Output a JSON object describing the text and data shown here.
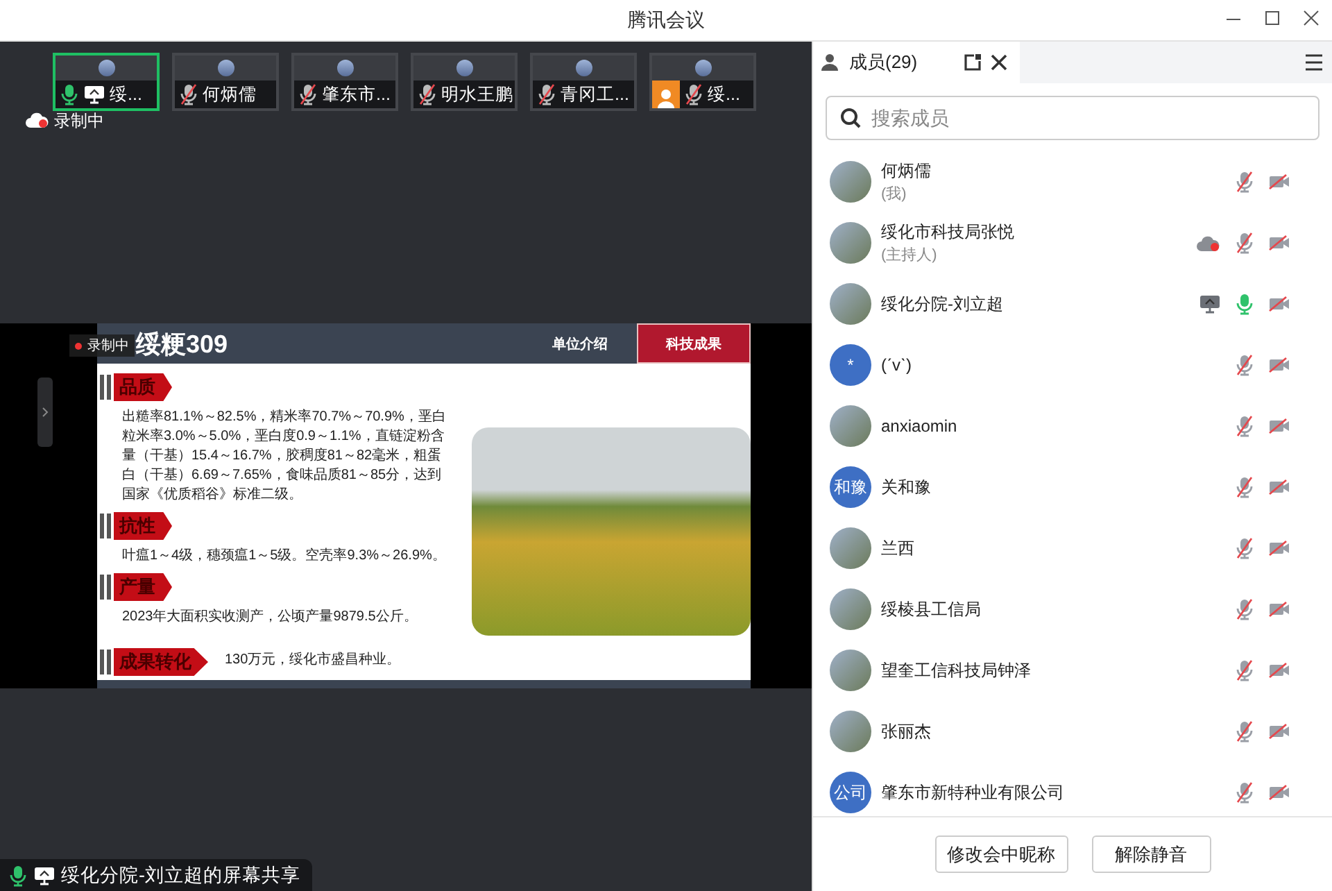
{
  "window": {
    "title": "腾讯会议"
  },
  "thumbnails": [
    {
      "name": "绥...",
      "mic_on": true,
      "sharing": true,
      "selected": true,
      "profile_badge": false
    },
    {
      "name": "何炳儒",
      "mic_on": false,
      "sharing": false,
      "selected": false,
      "profile_badge": false
    },
    {
      "name": "肇东市...",
      "mic_on": false,
      "sharing": false,
      "selected": false,
      "profile_badge": false
    },
    {
      "name": "明水王鹏",
      "mic_on": false,
      "sharing": false,
      "selected": false,
      "profile_badge": false
    },
    {
      "name": "青冈工...",
      "mic_on": false,
      "sharing": false,
      "selected": false,
      "profile_badge": false
    },
    {
      "name": "绥...",
      "mic_on": false,
      "sharing": false,
      "selected": false,
      "profile_badge": true
    }
  ],
  "recording_label": "录制中",
  "slide": {
    "recording_label": "录制中",
    "title": "绥粳309",
    "nav": [
      {
        "label": "单位介绍",
        "selected": false
      },
      {
        "label": "科技成果",
        "selected": true
      }
    ],
    "sections": [
      {
        "kind": "stacked",
        "heading": "品质",
        "text": "出糙率81.1%～82.5%，精米率70.7%～70.9%，垩白粒米率3.0%～5.0%，垩白度0.9～1.1%，直链淀粉含量（干基）15.4～16.7%，胶稠度81～82毫米，粗蛋白（干基）6.69～7.65%，食味品质81～85分，达到国家《优质稻谷》标准二级。"
      },
      {
        "kind": "stacked",
        "heading": "抗性",
        "text": "叶瘟1～4级，穗颈瘟1～5级。空壳率9.3%～26.9%。"
      },
      {
        "kind": "stacked",
        "heading": "产量",
        "text": "2023年大面积实收测产，公顷产量9879.5公斤。"
      },
      {
        "kind": "inline",
        "heading": "成果转化",
        "text": "130万元，绥化市盛昌种业。"
      }
    ]
  },
  "share_caption": {
    "text": "绥化分院-刘立超的屏幕共享",
    "mic_on": true
  },
  "panel": {
    "tab": {
      "label": "成员(29)"
    },
    "search": {
      "placeholder": "搜索成员"
    },
    "members": [
      {
        "name": "何炳儒",
        "note": "(我)",
        "avatar": {
          "kind": "photo"
        },
        "mic_on": false,
        "camera_on": false,
        "recording": false,
        "sharing": false
      },
      {
        "name": "绥化市科技局张悦",
        "note": "(主持人)",
        "avatar": {
          "kind": "photo"
        },
        "mic_on": false,
        "camera_on": false,
        "recording": true,
        "sharing": false
      },
      {
        "name": "绥化分院-刘立超",
        "avatar": {
          "kind": "photo"
        },
        "mic_on": true,
        "camera_on": false,
        "recording": false,
        "sharing": true
      },
      {
        "name": "(ˊvˋ)",
        "avatar": {
          "kind": "text",
          "text": "*"
        },
        "mic_on": false,
        "camera_on": false,
        "recording": false,
        "sharing": false
      },
      {
        "name": "anxiaomin",
        "avatar": {
          "kind": "photo"
        },
        "mic_on": false,
        "camera_on": false,
        "recording": false,
        "sharing": false
      },
      {
        "name": "关和豫",
        "avatar": {
          "kind": "text",
          "text": "和豫"
        },
        "mic_on": false,
        "camera_on": false,
        "recording": false,
        "sharing": false
      },
      {
        "name": "兰西",
        "avatar": {
          "kind": "photo"
        },
        "mic_on": false,
        "camera_on": false,
        "recording": false,
        "sharing": false
      },
      {
        "name": "绥棱县工信局",
        "avatar": {
          "kind": "photo"
        },
        "mic_on": false,
        "camera_on": false,
        "recording": false,
        "sharing": false
      },
      {
        "name": "望奎工信科技局钟泽",
        "avatar": {
          "kind": "photo"
        },
        "mic_on": false,
        "camera_on": false,
        "recording": false,
        "sharing": false
      },
      {
        "name": "张丽杰",
        "avatar": {
          "kind": "photo"
        },
        "mic_on": false,
        "camera_on": false,
        "recording": false,
        "sharing": false
      },
      {
        "name": "肇东市新特种业有限公司",
        "avatar": {
          "kind": "text",
          "text": "公司"
        },
        "mic_on": false,
        "camera_on": false,
        "recording": false,
        "sharing": false
      }
    ],
    "buttons": [
      "修改会中昵称",
      "解除静音"
    ]
  }
}
